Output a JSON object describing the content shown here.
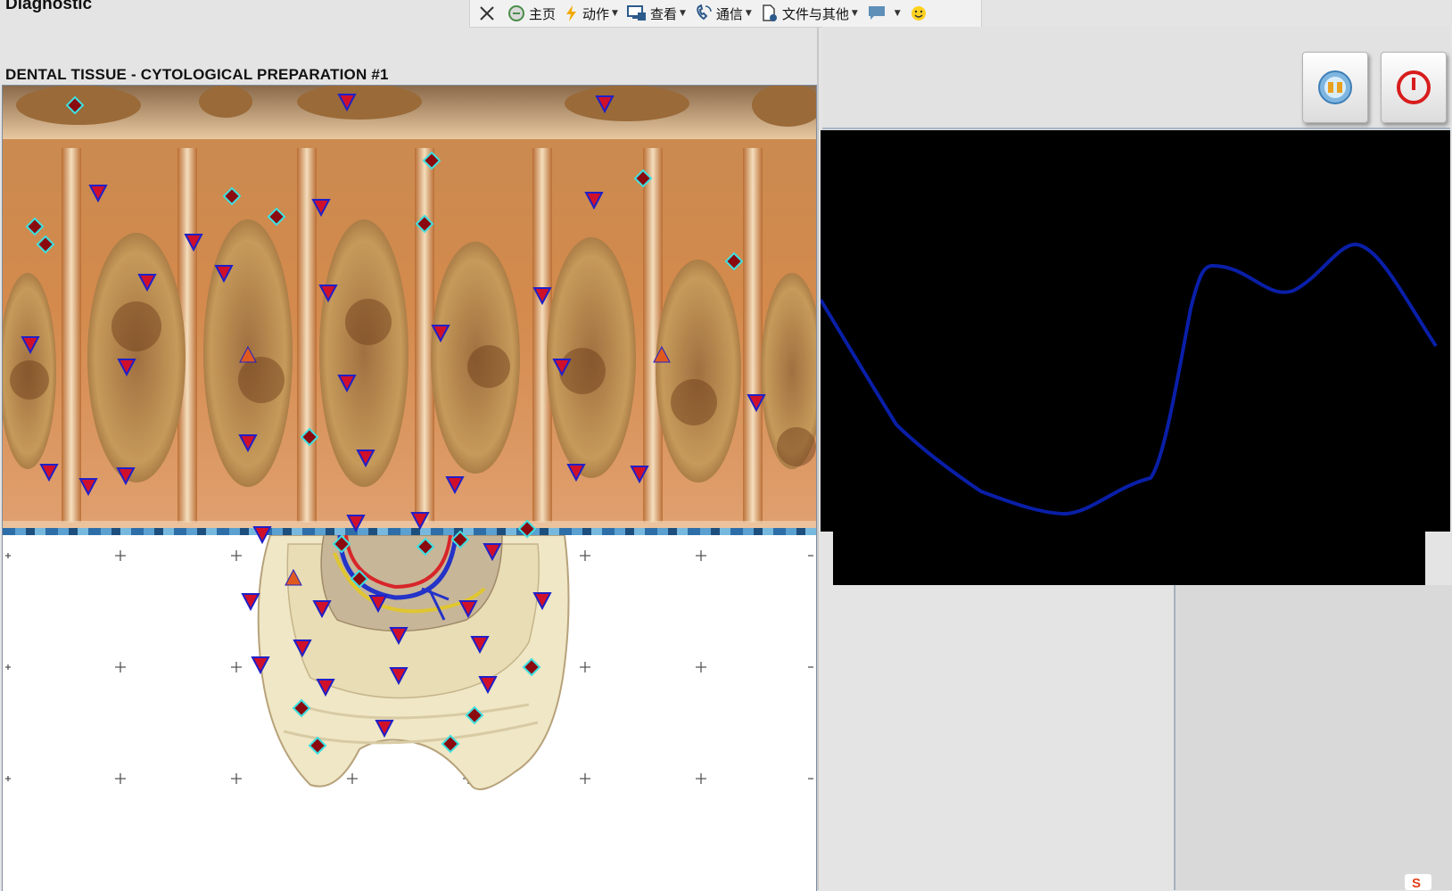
{
  "app": {
    "title": "Diagnostic"
  },
  "toolbar": {
    "close_label": "",
    "home_label": "主页",
    "actions_label": "动作",
    "view_label": "查看",
    "comm_label": "通信",
    "files_label": "文件与其他"
  },
  "panel": {
    "title": "DENTAL TISSUE - CYTOLOGICAL PREPARATION #1"
  },
  "colors": {
    "marker_triangle": "#d0102a",
    "marker_triangle_border": "#2020c8",
    "marker_diamond_fill": "#8a0a10",
    "marker_diamond_border": "#3ee0e0",
    "marker_up": "#e05a20",
    "graph_line": "#0a1fa8",
    "graph_bg": "#000000"
  },
  "icons": {
    "close": "close-icon",
    "home": "home-icon",
    "actions": "lightning-icon",
    "view": "monitor-icon",
    "comm": "phone-icon",
    "files": "file-icon",
    "chat": "chat-icon",
    "emoji": "smiley-icon",
    "media": "media-icon",
    "power": "power-icon"
  }
}
